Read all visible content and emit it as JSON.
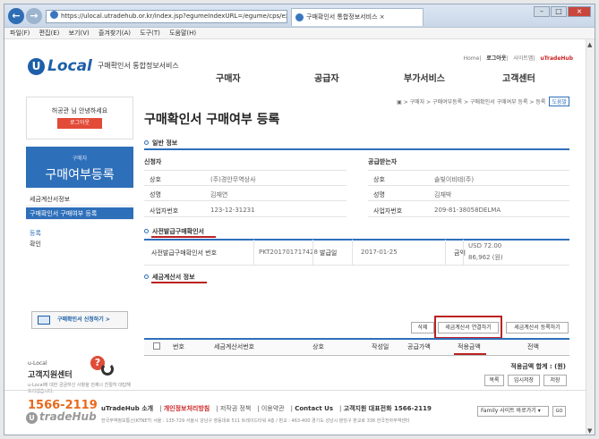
{
  "browser": {
    "address": "https://ulocal.utradehub.or.kr/index.jsp?egumeIndexURL=/egume/cps/execInf/n",
    "tab_title": "구매확인서 통합정보서비스",
    "tab_close": "×",
    "back": "←",
    "forward": "→",
    "window_controls": [
      "–",
      "□",
      "×"
    ],
    "menu": [
      "파일(F)",
      "편집(E)",
      "보기(V)",
      "즐겨찾기(A)",
      "도구(T)",
      "도움말(H)"
    ]
  },
  "header": {
    "logo_letter": "U",
    "logo_text": "Local",
    "logo_sub": "구매확인서 통합정보서비스",
    "toplinks": [
      "Home",
      "로그아웃",
      "사이트맵",
      "uTradeHub"
    ],
    "gnb": [
      "구매자",
      "공급자",
      "부가서비스",
      "고객센터"
    ]
  },
  "sidebar": {
    "greeting": "허공관 님 안녕하세요",
    "logout_button": "로그아웃",
    "section_small": "구매자",
    "section_title": "구매여부등록",
    "items": [
      "세금계산서정보",
      "구매확인서 구매여부 등록",
      "등록",
      "확인"
    ],
    "apply_button": "구매확인서 신청하기 >",
    "cs_small": "u-Local",
    "cs_title": "고객지원센터",
    "cs_desc": "u-Local에 대한 궁금하신 사항을 언제나 친절히 대답해드리겠습니다.",
    "cs_phone": "1566-2119"
  },
  "main": {
    "breadcrumb": "> 구매자 > 구매여부등록 > 구매확인서 구매여부 등록 > 등록",
    "help": "도움말",
    "title": "구매확인서 구매여부 등록",
    "section1": "일반 정보",
    "buyer_title": "신청자",
    "supplier_title": "공급받는자",
    "buyer": [
      {
        "label": "상호",
        "value": "(주)경안무역상사"
      },
      {
        "label": "성명",
        "value": "김재연"
      },
      {
        "label": "사업자번호",
        "value": "123-12-31231"
      }
    ],
    "supplier": [
      {
        "label": "상호",
        "value": "솔빛이비테(주)"
      },
      {
        "label": "성명",
        "value": "김재박"
      },
      {
        "label": "사업자번호",
        "value": "209-81-38058DELMA"
      }
    ],
    "section2": "사전발급구매확인서",
    "pre": {
      "num_label": "사전발급구매확인서 번호",
      "num_value": "PKT201701717428",
      "date_label": "발급일",
      "date_value": "2017-01-25",
      "amount_label": "금액",
      "amount_usd": "USD 72.00",
      "amount_krw": "86,962 (원)"
    },
    "section3": "세금계산서 정보",
    "buttons": [
      "삭제",
      "세금계산서 연결하기",
      "세금계산서 등록하기"
    ],
    "columns": [
      "번호",
      "세금계산서번호",
      "상호",
      "작성일",
      "공급가액",
      "적용금액",
      "전액"
    ],
    "sum_label": "적용금액 합계 : (원)",
    "bottom_buttons": [
      "목록",
      "임시저장",
      "저장"
    ]
  },
  "footer": {
    "logo_letter": "U",
    "logo_text": "tradeHub",
    "links": [
      "uTradeHub 소개",
      "개인정보처리방침",
      "저작권 정책",
      "이용약관",
      "Contact Us",
      "고객지원 대표전화 1566-2119"
    ],
    "address": "한국무역정보통신(KTNET) 서울 : 135-729 서울시 강남구 영동대로 511 트레이드타워 4층 / 판교 : 463-400 경기도 성남시 분당구 판교로 338 한국전자무역센터",
    "family_site": "Family 사이트 바로가기",
    "go": "GO"
  }
}
